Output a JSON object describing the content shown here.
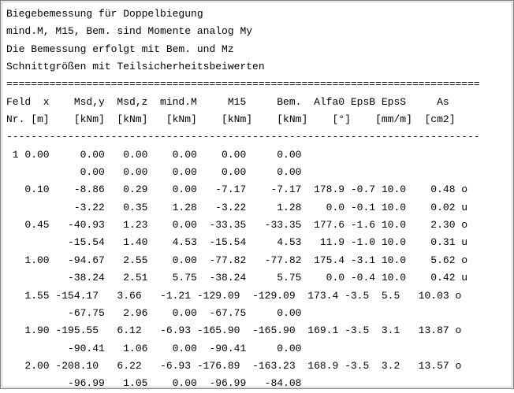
{
  "document": {
    "header_lines": [
      "Biegebemessung für Doppelbiegung",
      "mind.M, M15, Bem. sind Momente analog My",
      "Die Bemessung erfolgt mit Bem. und Mz",
      "Schnittgrößen mit Teilsicherheitsbeiwerten"
    ],
    "double_rule": "=============================================================================",
    "column_header_1": "Feld  x    Msd,y  Msd,z  mind.M     M15     Bem.  Alfa0 EpsB EpsS     As",
    "column_header_2": "Nr. [m]    [kNm]  [kNm]   [kNm]    [kNm]    [kNm]    [°]    [mm/m]  [cm2]",
    "single_rule": "-----------------------------------------------------------------------------",
    "rows": [
      " 1 0.00     0.00   0.00    0.00    0.00     0.00",
      "            0.00   0.00    0.00    0.00     0.00",
      "   0.10    -8.86   0.29    0.00   -7.17    -7.17  178.9 -0.7 10.0    0.48 o",
      "           -3.22   0.35    1.28   -3.22     1.28    0.0 -0.1 10.0    0.02 u",
      "   0.45   -40.93   1.23    0.00  -33.35   -33.35  177.6 -1.6 10.0    2.30 o",
      "          -15.54   1.40    4.53  -15.54     4.53   11.9 -1.0 10.0    0.31 u",
      "   1.00   -94.67   2.55    0.00  -77.82   -77.82  175.4 -3.1 10.0    5.62 o",
      "          -38.24   2.51    5.75  -38.24     5.75    0.0 -0.4 10.0    0.42 u",
      "   1.55 -154.17   3.66   -1.21 -129.09  -129.09  173.4 -3.5  5.5   10.03 o",
      "          -67.75   2.96    0.00  -67.75     0.00",
      "   1.90 -195.55   6.12   -6.93 -165.90  -165.90  169.1 -3.5  3.1   13.87 o",
      "          -90.41   1.06    0.00  -90.41     0.00",
      "   2.00 -208.10   6.22   -6.93 -176.89  -163.23  168.9 -3.5  3.2   13.57 o",
      "          -96.99   1.05    0.00  -96.99   -84.08"
    ]
  }
}
